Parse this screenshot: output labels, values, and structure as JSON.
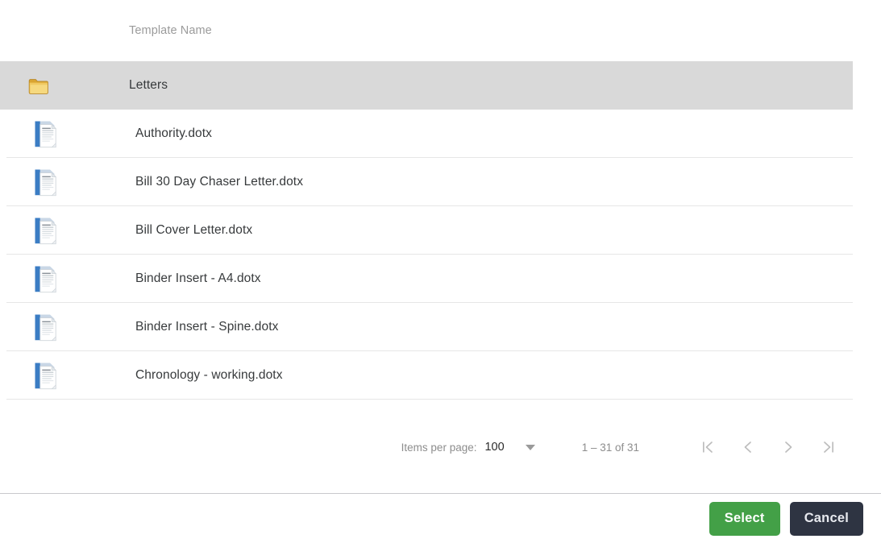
{
  "table": {
    "header": {
      "name_column_label": "Template Name",
      "icon_column_label": ""
    },
    "rows": [
      {
        "icon": "folder-icon",
        "name": "Letters",
        "selected": true
      },
      {
        "icon": "docx-file-icon",
        "name": "Authority.dotx",
        "selected": false
      },
      {
        "icon": "docx-file-icon",
        "name": "Bill 30 Day Chaser Letter.dotx",
        "selected": false
      },
      {
        "icon": "docx-file-icon",
        "name": "Bill Cover Letter.dotx",
        "selected": false
      },
      {
        "icon": "docx-file-icon",
        "name": "Binder Insert - A4.dotx",
        "selected": false
      },
      {
        "icon": "docx-file-icon",
        "name": "Binder Insert - Spine.dotx",
        "selected": false
      },
      {
        "icon": "docx-file-icon",
        "name": "Chronology - working.dotx",
        "selected": false
      }
    ]
  },
  "paginator": {
    "items_per_page_label": "Items per page:",
    "items_per_page_value": "100",
    "items_per_page_options": [
      "100"
    ],
    "range_label": "1 – 31 of 31",
    "first_page_icon": "first-page-icon",
    "previous_page_icon": "chevron-left-icon",
    "next_page_icon": "chevron-right-icon",
    "last_page_icon": "last-page-icon"
  },
  "footer": {
    "select_label": "Select",
    "cancel_label": "Cancel"
  },
  "colors": {
    "select_button": "#43a047",
    "cancel_button": "#2e3442",
    "selected_row": "#d9d9d9",
    "row_divider": "#e6e6e6",
    "header_text": "#9b9b9b",
    "row_text": "#373a3c",
    "scrollbar_thumb": "#9e9e9e",
    "folder_icon": "#e8b84b",
    "docx_icon_accent": "#3b7dc4"
  },
  "scroll": {
    "thumb_visible": true
  }
}
